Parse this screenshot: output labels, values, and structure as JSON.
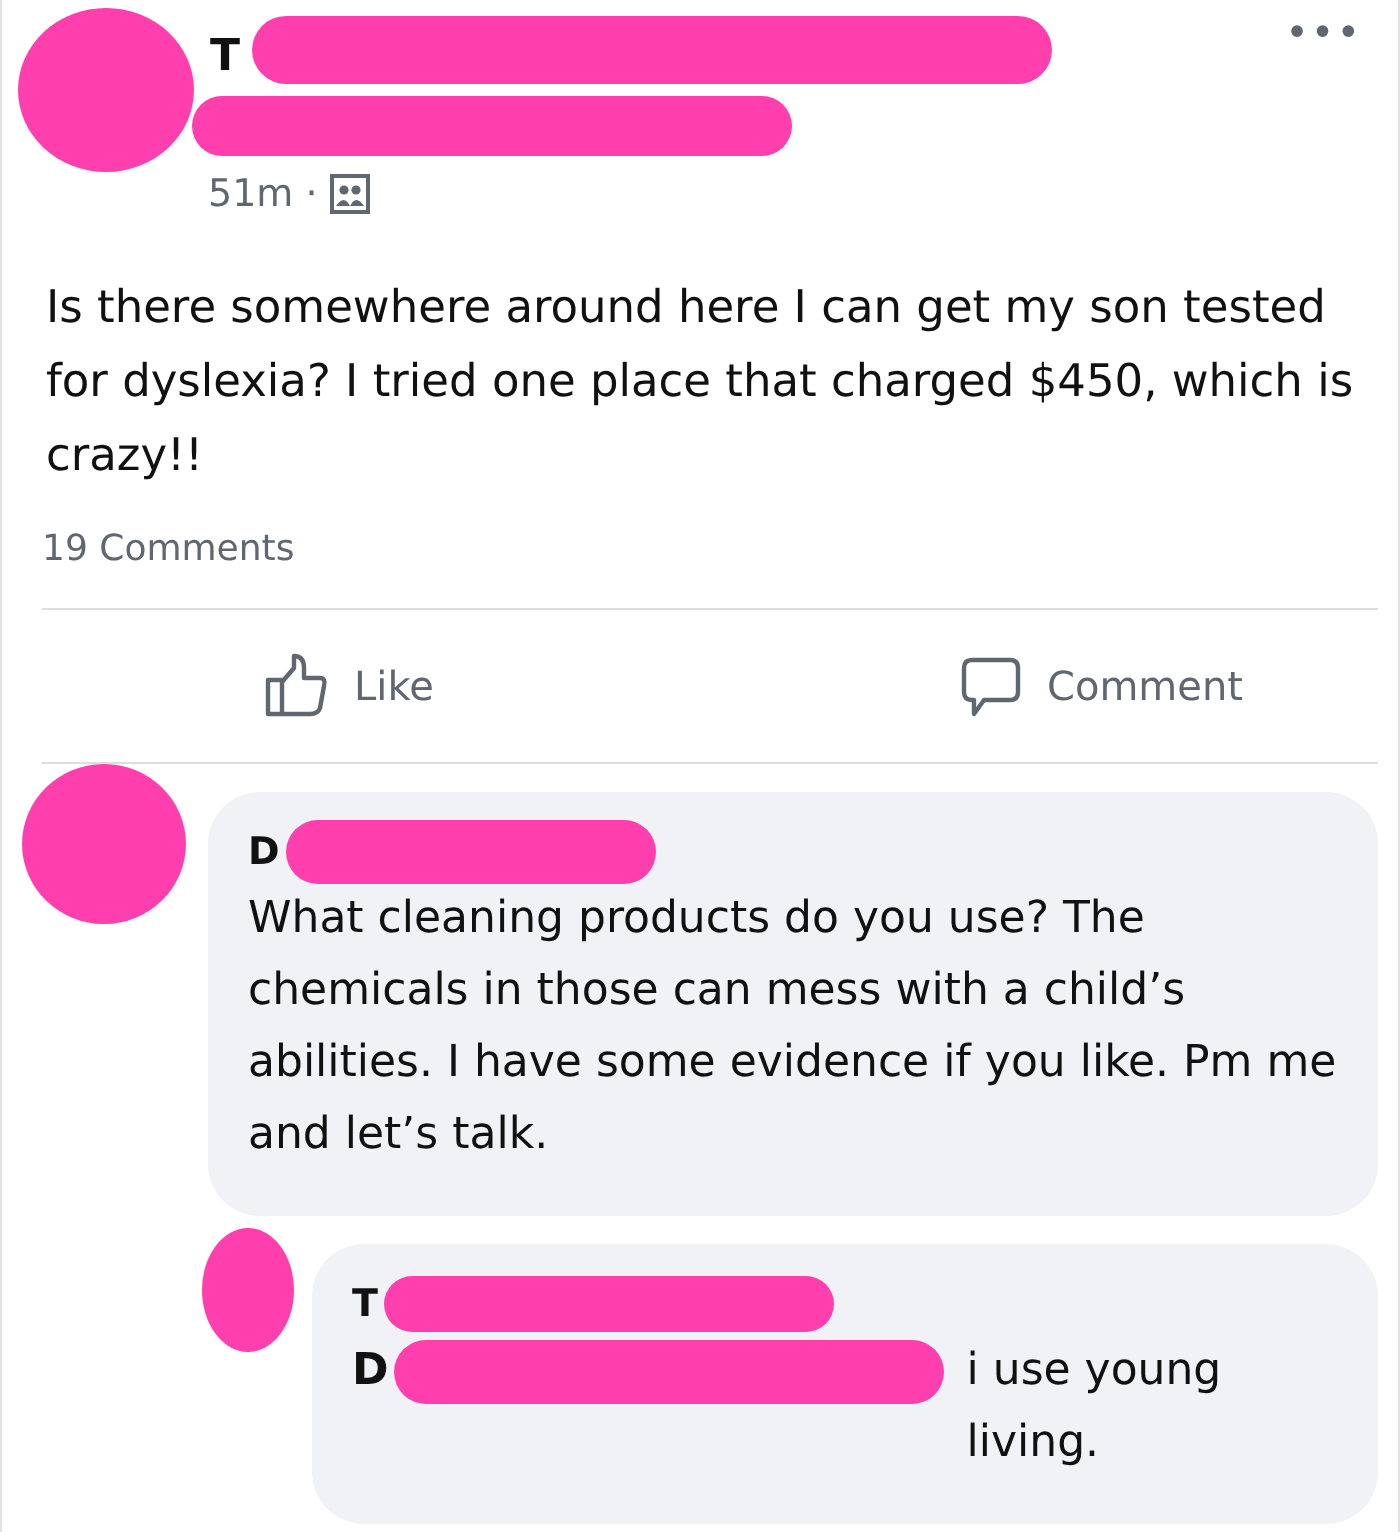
{
  "post": {
    "author": "T",
    "more": "•••",
    "time": "51m",
    "separator": "·",
    "body": "Is there somewhere around here I can get my son tested for dyslexia? I tried one place that charged $450, which is crazy!!",
    "comments_count": "19 Comments"
  },
  "actions": [
    {
      "kind": "like",
      "label": "Like"
    },
    {
      "kind": "comment",
      "label": "Comment"
    }
  ],
  "comments": [
    {
      "author": "D",
      "reply": false,
      "text": "What cleaning products do you use?  The chemicals in those can mess with a child’s abilities. I have some evidence if you like. Pm me and let’s talk."
    },
    {
      "author": "T",
      "reply": true,
      "mention": "D",
      "text": "i use young living."
    }
  ]
}
